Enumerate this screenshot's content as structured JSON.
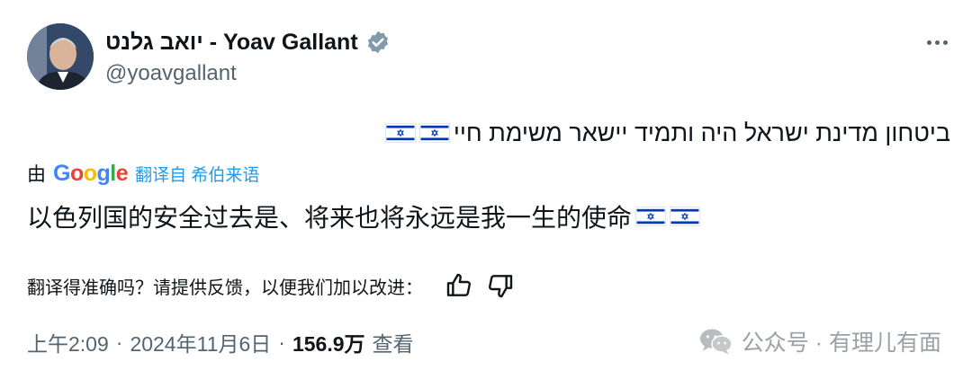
{
  "author": {
    "display_name": "יואב גלנט - Yoav Gallant",
    "handle": "@yoavgallant",
    "verified_icon": "verified-badge-icon",
    "avatar": "avatar"
  },
  "menu": {
    "more_icon": "more-horizontal-icon"
  },
  "tweet": {
    "original_text": "ביטחון מדינת ישראל היה ותמיד יישאר משימת חיי",
    "flags": [
      "israel-flag",
      "israel-flag"
    ]
  },
  "translation": {
    "by_label": "由",
    "provider": "Google",
    "action": "翻译自 希伯来语",
    "text": "以色列国的安全过去是、将来也将永远是我一生的使命"
  },
  "feedback": {
    "question": "翻译得准确吗？请提供反馈，以便我们加以改进：",
    "thumbs_up_icon": "thumbs-up-icon",
    "thumbs_down_icon": "thumbs-down-icon"
  },
  "meta": {
    "time": "上午2:09",
    "sep1": "·",
    "date": "2024年11月6日",
    "sep2": "·",
    "views": "156.9万",
    "views_label": "查看"
  },
  "watermark": {
    "text": "公众号 · 有理儿有面",
    "icon": "wechat-icon"
  },
  "colors": {
    "text": "#0f1419",
    "secondary": "#536471",
    "link": "#1d9bf0",
    "verified": "#829aab",
    "flag_blue": "#0038b8"
  }
}
